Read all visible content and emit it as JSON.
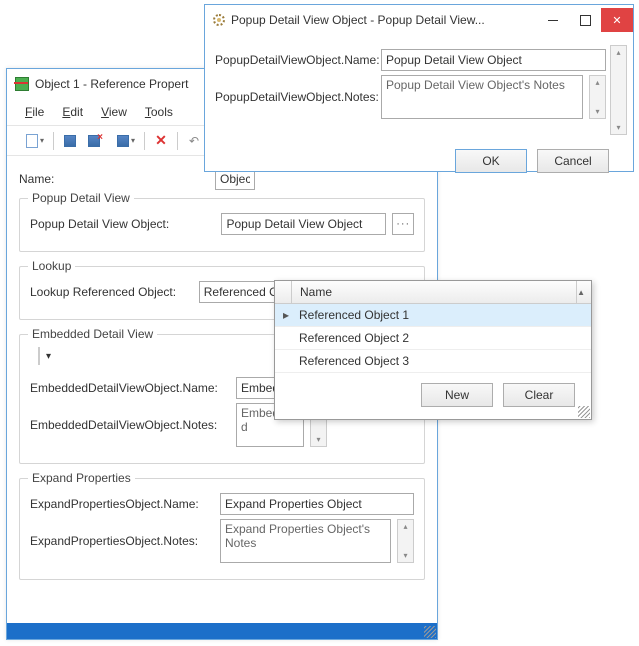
{
  "mainWindow": {
    "title": "Object 1 - Reference Propert",
    "menu": {
      "file": "File",
      "edit": "Edit",
      "view": "View",
      "tools": "Tools"
    },
    "nameLabel": "Name:",
    "nameValue": "Objec",
    "popupGroup": {
      "legend": "Popup Detail View",
      "label": "Popup Detail View Object:",
      "value": "Popup Detail View Object"
    },
    "lookupGroup": {
      "legend": "Lookup",
      "label": "Lookup Referenced Object:",
      "value": "Referenced Object 1"
    },
    "embeddedGroup": {
      "legend": "Embedded Detail View",
      "nameLabel": "EmbeddedDetailViewObject.Name:",
      "nameValue": "Embedded",
      "notesLabel": "EmbeddedDetailViewObject.Notes:",
      "notesValue": "Embedded"
    },
    "expandGroup": {
      "legend": "Expand Properties",
      "nameLabel": "ExpandPropertiesObject.Name:",
      "nameValue": "Expand Properties Object",
      "notesLabel": "ExpandPropertiesObject.Notes:",
      "notesValue": "Expand Properties Object's Notes"
    }
  },
  "popupDialog": {
    "title": "Popup Detail View Object - Popup Detail View...",
    "nameLabel": "PopupDetailViewObject.Name:",
    "nameValue": "Popup Detail View Object",
    "notesLabel": "PopupDetailViewObject.Notes:",
    "notesValue": "Popup Detail View Object's Notes",
    "ok": "OK",
    "cancel": "Cancel"
  },
  "dropdown": {
    "header": "Name",
    "items": [
      "Referenced Object 1",
      "Referenced Object 2",
      "Referenced Object 3"
    ],
    "selectedIndex": 0,
    "new": "New",
    "clear": "Clear"
  }
}
